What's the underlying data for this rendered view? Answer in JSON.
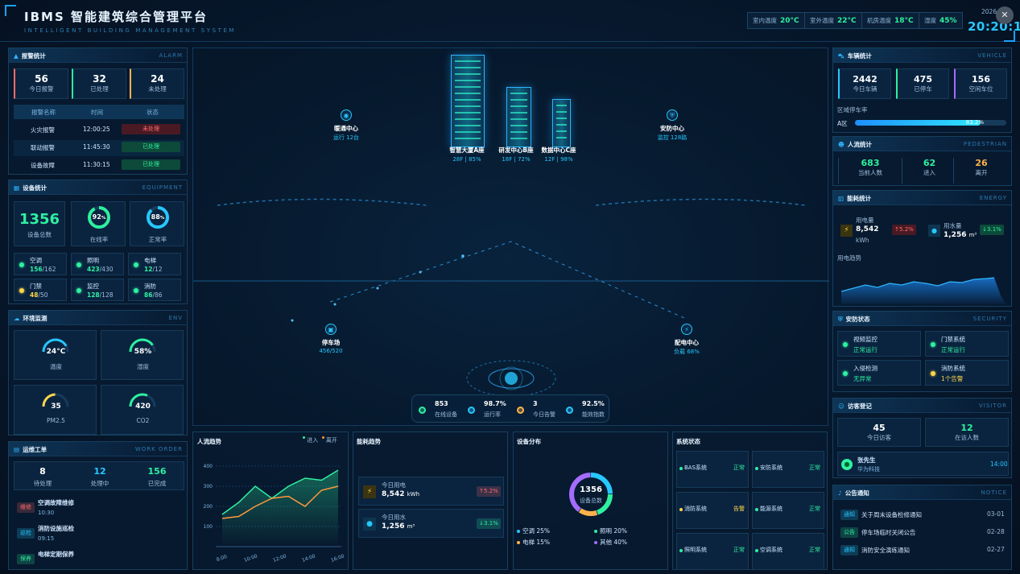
{
  "header": {
    "title": "IBMS 智能建筑综合管理平台",
    "subtitle": "INTELLIGENT BUILDING MANAGEMENT SYSTEM",
    "chips": [
      {
        "label": "室内温度",
        "value": "20°C"
      },
      {
        "label": "室外温度",
        "value": "22°C"
      },
      {
        "label": "机房温度",
        "value": "18°C"
      },
      {
        "label": "湿度",
        "value": "45%"
      }
    ],
    "date": "2026",
    "time": "20:20:10",
    "fullscreen_icon": "close-icon"
  },
  "alarm": {
    "title": "报警统计",
    "en": "ALARM",
    "stats": [
      {
        "value": "56",
        "label": "今日报警"
      },
      {
        "value": "32",
        "label": "已处理"
      },
      {
        "value": "24",
        "label": "未处理"
      }
    ],
    "columns": [
      "报警名称",
      "时间",
      "状态"
    ],
    "rows": [
      {
        "name": "火灾报警",
        "time": "12:00:25",
        "status": "未处理"
      },
      {
        "name": "联动报警",
        "time": "11:45:30",
        "status": "已处理"
      },
      {
        "name": "设备故障",
        "time": "11:30:15",
        "status": "已处理"
      }
    ]
  },
  "equipment": {
    "title": "设备统计",
    "en": "EQUIPMENT",
    "total": "1356",
    "total_label": "设备总数",
    "online": "92",
    "online_unit": "%",
    "online_label": "在线率",
    "normal": "88",
    "normal_unit": "%",
    "normal_label": "正常率",
    "items": [
      {
        "name": "空调",
        "on": "156",
        "all": "/162",
        "color": "#2ff0a0"
      },
      {
        "name": "照明",
        "on": "423",
        "all": "/430",
        "color": "#2ff0a0"
      },
      {
        "name": "电梯",
        "on": "12",
        "all": "/12",
        "color": "#2ff0a0"
      },
      {
        "name": "门禁",
        "on": "48",
        "all": "/50",
        "color": "#ffd54a"
      },
      {
        "name": "监控",
        "on": "128",
        "all": "/128",
        "color": "#2ff0a0"
      },
      {
        "name": "消防",
        "on": "86",
        "all": "/86",
        "color": "#2ff0a0"
      }
    ]
  },
  "env": {
    "title": "环境监测",
    "en": "ENV",
    "items": [
      {
        "value": "24°C",
        "label": "温度",
        "level": 0.6,
        "color": "#27c7ff"
      },
      {
        "value": "58%",
        "label": "湿度",
        "level": 0.58,
        "color": "#2ff0a0"
      },
      {
        "value": "35",
        "label": "PM2.5",
        "level": 0.35,
        "color": "#ffd54a"
      },
      {
        "value": "420",
        "label": "CO2",
        "level": 0.45,
        "color": "#2ff0a0"
      }
    ]
  },
  "workorder": {
    "title": "运维工单",
    "en": "WORK ORDER",
    "stats": [
      {
        "value": "8",
        "label": "待处理",
        "color": "#ffffff"
      },
      {
        "value": "12",
        "label": "处理中",
        "color": "#27c7ff"
      },
      {
        "value": "156",
        "label": "已完成",
        "color": "#2ff0a0"
      }
    ],
    "items": [
      {
        "tag": "维修",
        "name": "空调故障维修",
        "time": "10:30",
        "color": "#ff6b6b"
      },
      {
        "tag": "巡检",
        "name": "消防设施巡检",
        "time": "09:15",
        "color": "#27c7ff"
      },
      {
        "tag": "保养",
        "name": "电梯定期保养",
        "time": "",
        "color": "#2ff0a0"
      }
    ]
  },
  "scene": {
    "buildings": [
      {
        "name": "智慧大厦A座",
        "info": "28F | 85%"
      },
      {
        "name": "研发中心B座",
        "info": "18F | 72%"
      },
      {
        "name": "数据中心C座",
        "info": "12F | 98%"
      }
    ],
    "nodes": [
      {
        "name": "暖通中心",
        "info": "运行 12台",
        "icon": "hvac-icon"
      },
      {
        "name": "安防中心",
        "info": "监控 128路",
        "icon": "shield-icon"
      },
      {
        "name": "停车场",
        "info": "456/520",
        "icon": "parking-icon"
      },
      {
        "name": "配电中心",
        "info": "负载 68%",
        "icon": "lightning-icon"
      }
    ],
    "kpis": [
      {
        "value": "853",
        "label": "在线设备",
        "color": "#2ff0a0"
      },
      {
        "value": "98.7%",
        "label": "运行率",
        "color": "#27c7ff"
      },
      {
        "value": "3",
        "label": "今日告警",
        "color": "#ffb24a"
      },
      {
        "value": "92.5%",
        "label": "能效指数",
        "color": "#27c7ff"
      }
    ]
  },
  "flow": {
    "title": "人流趋势",
    "legend_in": "进入",
    "legend_out": "离开"
  },
  "energy_trend": {
    "title": "能耗趋势",
    "items": [
      {
        "label": "今日用电",
        "value": "8,542",
        "unit": "kWh",
        "change": "↑5.2%",
        "color": "#ff6b6b"
      },
      {
        "label": "今日用水",
        "value": "1,256",
        "unit": "m³",
        "change": "↓3.1%",
        "color": "#2ff0a0"
      }
    ]
  },
  "dist": {
    "title": "设备分布",
    "total": "1356",
    "total_label": "设备总数",
    "legend": [
      {
        "name": "空调",
        "pct": "25%",
        "color": "#27c7ff"
      },
      {
        "name": "照明",
        "pct": "20%",
        "color": "#2ff0a0"
      },
      {
        "name": "电梯",
        "pct": "15%",
        "color": "#ffb24a"
      },
      {
        "name": "其他",
        "pct": "40%",
        "color": "#a66bff"
      }
    ]
  },
  "sys": {
    "title": "系统状态",
    "items": [
      {
        "name": "BAS系统",
        "status": "正常",
        "color": "#2ff0a0"
      },
      {
        "name": "安防系统",
        "status": "正常",
        "color": "#2ff0a0"
      },
      {
        "name": "消防系统",
        "status": "告警",
        "color": "#ffd54a"
      },
      {
        "name": "能源系统",
        "status": "正常",
        "color": "#2ff0a0"
      },
      {
        "name": "照明系统",
        "status": "正常",
        "color": "#2ff0a0"
      },
      {
        "name": "空调系统",
        "status": "正常",
        "color": "#2ff0a0"
      }
    ]
  },
  "vehicle": {
    "title": "车辆统计",
    "en": "VEHICLE",
    "stats": [
      {
        "value": "2442",
        "label": "今日车辆"
      },
      {
        "value": "475",
        "label": "已停车"
      },
      {
        "value": "156",
        "label": "空闲车位"
      }
    ],
    "zone_title": "区域停车率",
    "zone": "A区",
    "zone_rate": "83.2%",
    "zone_level": 0.832
  },
  "pedestrian": {
    "title": "人流统计",
    "en": "PEDESTRIAN",
    "stats": [
      {
        "value": "683",
        "label": "当前人数",
        "color": "#2ff0a0"
      },
      {
        "value": "62",
        "label": "进入",
        "color": "#2ff0a0"
      },
      {
        "value": "26",
        "label": "离开",
        "color": "#ffb24a"
      }
    ]
  },
  "energy": {
    "title": "能耗统计",
    "en": "ENERGY",
    "elec_label": "用电量",
    "elec_value": "8,542",
    "elec_unit": "kWh",
    "elec_change": "↑5.2%",
    "water_label": "用水量",
    "water_value": "1,256",
    "water_unit": "m³",
    "water_change": "↓3.1%",
    "trend_label": "用电趋势"
  },
  "security": {
    "title": "安防状态",
    "en": "SECURITY",
    "items": [
      {
        "name": "视频监控",
        "status": "正常运行",
        "color": "#2ff0a0"
      },
      {
        "name": "门禁系统",
        "status": "正常运行",
        "color": "#2ff0a0"
      },
      {
        "name": "入侵检测",
        "status": "无异常",
        "color": "#2ff0a0"
      },
      {
        "name": "消防系统",
        "status": "1个告警",
        "color": "#ffd54a"
      }
    ]
  },
  "visitor": {
    "title": "访客登记",
    "en": "VISITOR",
    "today": "45",
    "today_label": "今日访客",
    "inside": "12",
    "inside_label": "在访人数",
    "name": "张先生",
    "company": "华为科技",
    "time": "14:00"
  },
  "notice": {
    "title": "公告通知",
    "en": "NOTICE",
    "items": [
      {
        "tag": "通知",
        "text": "关于周末设备检修通知",
        "date": "03-01",
        "color": "#27c7ff"
      },
      {
        "tag": "公告",
        "text": "停车场临时关闭公告",
        "date": "02-28",
        "color": "#2ff0a0"
      },
      {
        "tag": "通知",
        "text": "消防安全演练通知",
        "date": "02-27",
        "color": "#27c7ff"
      }
    ]
  },
  "chart_data": {
    "type": "line",
    "x": [
      "8:00",
      "10:00",
      "12:00",
      "14:00",
      "16:00"
    ],
    "ylim": [
      0,
      400
    ],
    "yticks": [
      "400",
      "300",
      "200",
      "100"
    ],
    "series": [
      {
        "name": "进入",
        "color": "#2ff0a0",
        "values": [
          160,
          220,
          300,
          240,
          300,
          340,
          330,
          380
        ]
      },
      {
        "name": "离开",
        "color": "#ff9a3a",
        "values": [
          140,
          150,
          200,
          240,
          250,
          200,
          280,
          300
        ]
      }
    ]
  }
}
